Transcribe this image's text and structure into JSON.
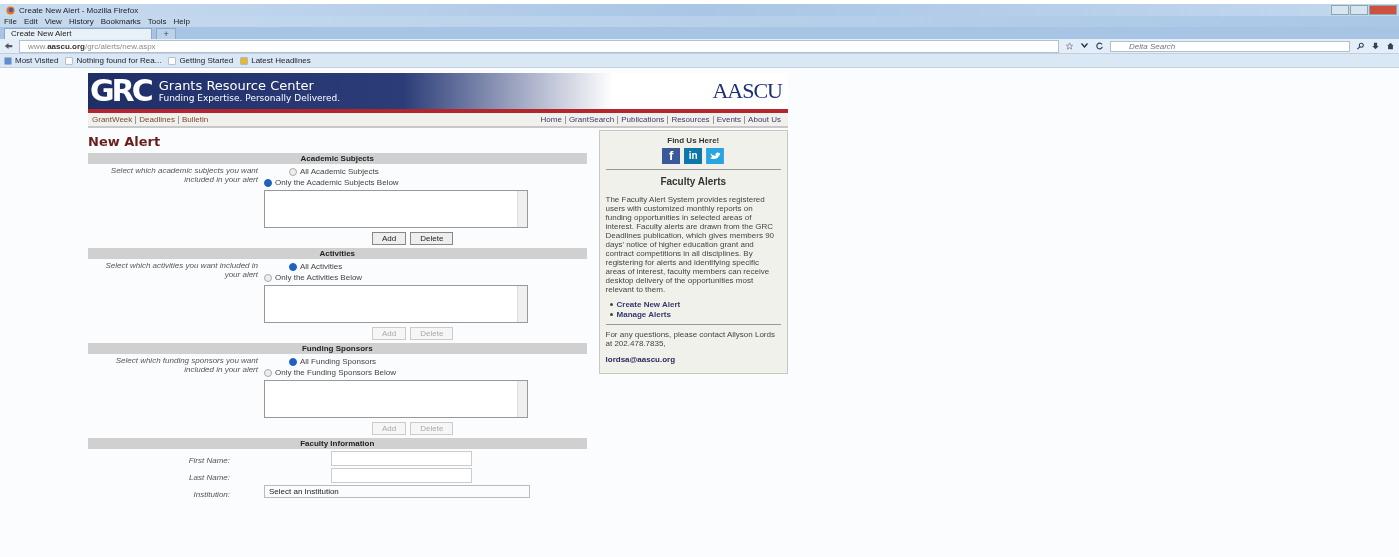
{
  "browser": {
    "window_title": "Create New Alert - Mozilla Firefox",
    "menu": [
      "File",
      "Edit",
      "View",
      "History",
      "Bookmarks",
      "Tools",
      "Help"
    ],
    "tabs": [
      {
        "label": "Create New Alert",
        "selected": true
      }
    ],
    "new_tab": "+",
    "url": "www.**aascu.org**/grc/alerts/new.aspx",
    "search": {
      "placeholder": "Delta Search"
    },
    "bookmarks": [
      "Most Visited",
      "Nothing found for Rea...",
      "Getting Started",
      "Latest Headlines"
    ]
  },
  "banner": {
    "logo": "GRC",
    "title": "Grants Resource Center",
    "tagline": "Funding Expertise. Personally Delivered.",
    "partner": "AASCU"
  },
  "nav_left": [
    "GrantWeek",
    "Deadlines",
    "Bulletin"
  ],
  "nav_right": [
    "Home",
    "GrantSearch",
    "Publications",
    "Resources",
    "Events",
    "About Us"
  ],
  "heading": "New Alert",
  "sections": [
    {
      "kind": "choice",
      "title": "Academic Subjects",
      "prompt": "Select which academic subjects you want included in your alert",
      "options": [
        {
          "label": "All Academic Subjects",
          "selected": false
        },
        {
          "label": "Only the Academic Subjects Below",
          "selected": true
        }
      ],
      "buttons": [
        {
          "label": "Add",
          "disabled": false
        },
        {
          "label": "Delete",
          "disabled": false
        }
      ]
    },
    {
      "kind": "choice",
      "title": "Activities",
      "prompt": "Select which activities you want included in your alert",
      "options": [
        {
          "label": "All Activities",
          "selected": true
        },
        {
          "label": "Only the Activities Below",
          "selected": false
        }
      ],
      "buttons": [
        {
          "label": "Add",
          "disabled": true
        },
        {
          "label": "Delete",
          "disabled": true
        }
      ]
    },
    {
      "kind": "choice",
      "title": "Funding Sponsors",
      "prompt": "Select which funding sponsors you want included in your alert",
      "options": [
        {
          "label": "All Funding Sponsors",
          "selected": true
        },
        {
          "label": "Only the Funding Sponsors Below",
          "selected": false
        }
      ],
      "buttons": [
        {
          "label": "Add",
          "disabled": true
        },
        {
          "label": "Delete",
          "disabled": true
        }
      ]
    },
    {
      "kind": "fields",
      "title": "Faculty Information",
      "fields": [
        {
          "kind": "text",
          "label": "First Name:"
        },
        {
          "kind": "text",
          "label": "Last Name:"
        },
        {
          "kind": "select",
          "label": "Institution:",
          "placeholder": "Select an Institution"
        }
      ]
    }
  ],
  "sidebar": {
    "find_us": "Find Us Here!",
    "social": [
      {
        "kind": "facebook",
        "label": "f"
      },
      {
        "kind": "linkedin",
        "label": "in"
      },
      {
        "kind": "twitter"
      }
    ],
    "title": "Faculty Alerts",
    "body": "The Faculty Alert System provides registered users with customized monthly reports on funding opportunities in selected areas of interest. Faculty alerts are drawn from the GRC Deadlines publication, which gives members 90 days' notice of higher education grant and contract competitions in all disciplines. By registering for alerts and identifying specific areas of interest, faculty members can receive desktop delivery of the opportunities most relevant to them.",
    "links": [
      "Create New Alert",
      "Manage Alerts"
    ],
    "contact": "For any questions, please contact Allyson Lords at 202.478.7835,",
    "email": "lordsa@aascu.org"
  }
}
